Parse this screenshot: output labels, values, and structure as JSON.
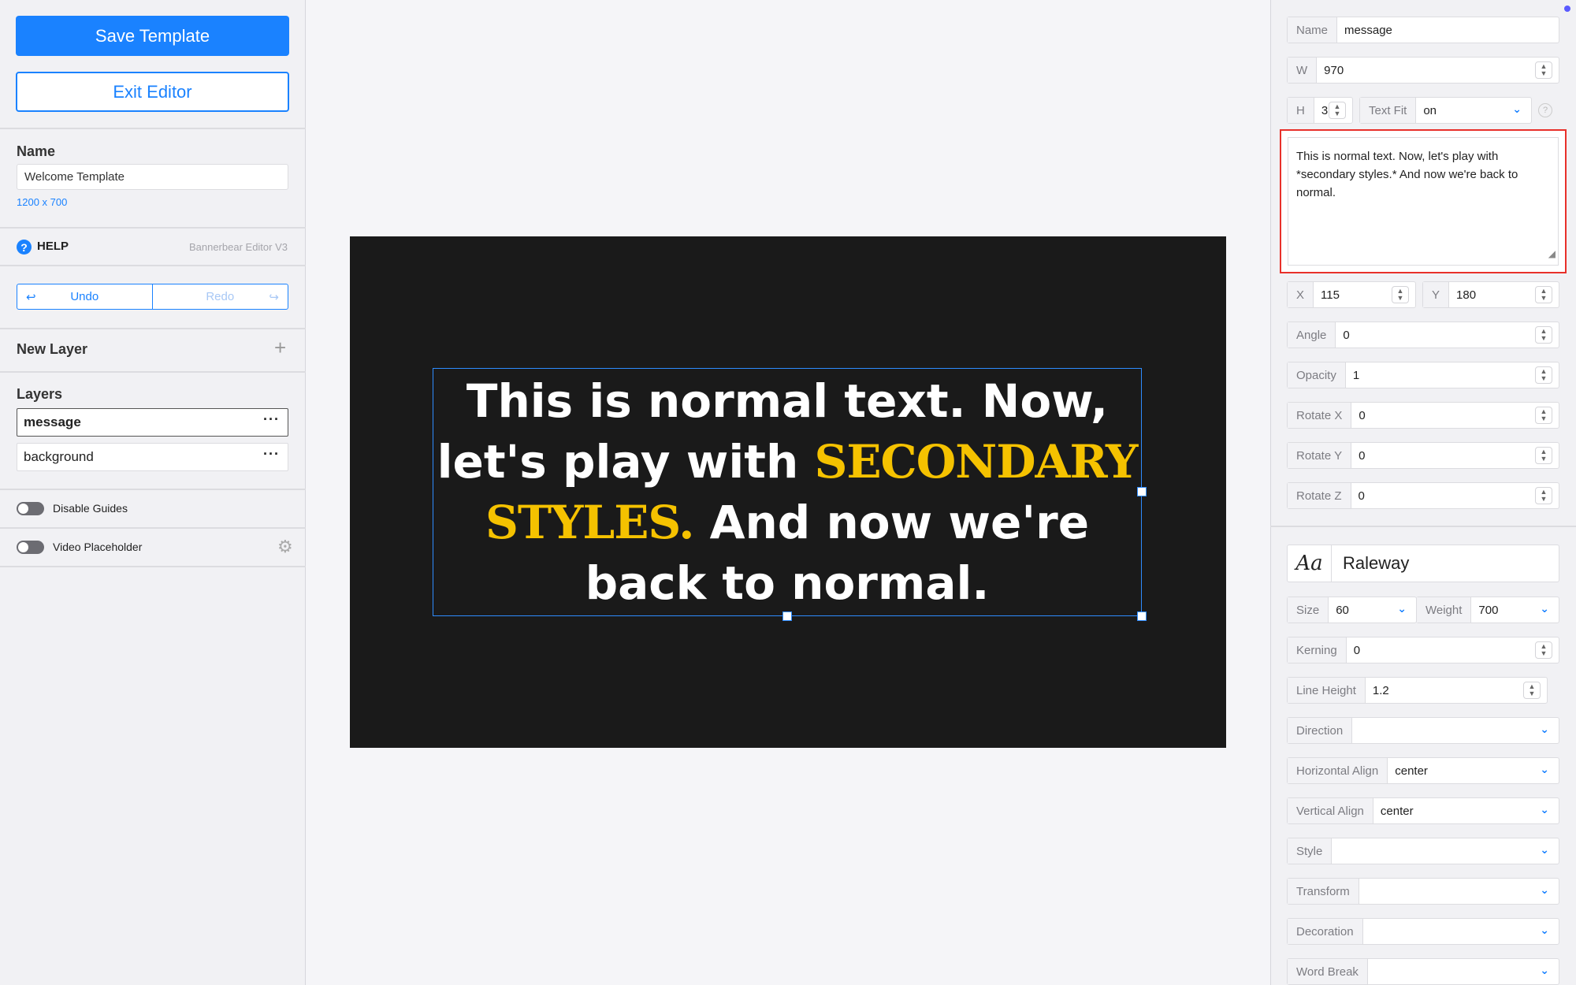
{
  "left_panel": {
    "save_label": "Save Template",
    "exit_label": "Exit Editor",
    "name_label": "Name",
    "name_value": "Welcome Template",
    "dimensions": "1200 x 700",
    "help_label": "HELP",
    "version": "Bannerbear Editor V3",
    "undo_label": "Undo",
    "redo_label": "Redo",
    "new_layer_label": "New Layer",
    "layers_label": "Layers",
    "layers": [
      {
        "name": "message"
      },
      {
        "name": "background"
      }
    ],
    "disable_guides_label": "Disable Guides",
    "video_placeholder_label": "Video Placeholder"
  },
  "canvas": {
    "text_before": "This is normal text. Now, let's play with ",
    "text_secondary": "SECONDARY STYLES.",
    "text_after": " And now we're back to normal.",
    "background_color": "#1a1a1a",
    "secondary_color": "#f5c200"
  },
  "right_panel": {
    "name_label": "Name",
    "name_value": "message",
    "w_label": "W",
    "w_value": "970",
    "h_label": "H",
    "h_value": "3",
    "textfit_label": "Text Fit",
    "textfit_value": "on",
    "text_value": "This is normal text. Now, let's play with *secondary styles.* And now we're back to normal.",
    "x_label": "X",
    "x_value": "115",
    "y_label": "Y",
    "y_value": "180",
    "angle_label": "Angle",
    "angle_value": "0",
    "opacity_label": "Opacity",
    "opacity_value": "1",
    "rotatex_label": "Rotate X",
    "rotatex_value": "0",
    "rotatey_label": "Rotate Y",
    "rotatey_value": "0",
    "rotatez_label": "Rotate Z",
    "rotatez_value": "0",
    "font_name": "Raleway",
    "size_label": "Size",
    "size_value": "60",
    "weight_label": "Weight",
    "weight_value": "700",
    "kerning_label": "Kerning",
    "kerning_value": "0",
    "lineheight_label": "Line Height",
    "lineheight_value": "1.2",
    "direction_label": "Direction",
    "direction_value": "",
    "halign_label": "Horizontal Align",
    "halign_value": "center",
    "valign_label": "Vertical Align",
    "valign_value": "center",
    "style_label": "Style",
    "style_value": "",
    "transform_label": "Transform",
    "transform_value": "",
    "decoration_label": "Decoration",
    "decoration_value": "",
    "wordbreak_label": "Word Break",
    "wordbreak_value": ""
  },
  "accent_color": "#1a82ff",
  "highlight_color": "#e8302a"
}
